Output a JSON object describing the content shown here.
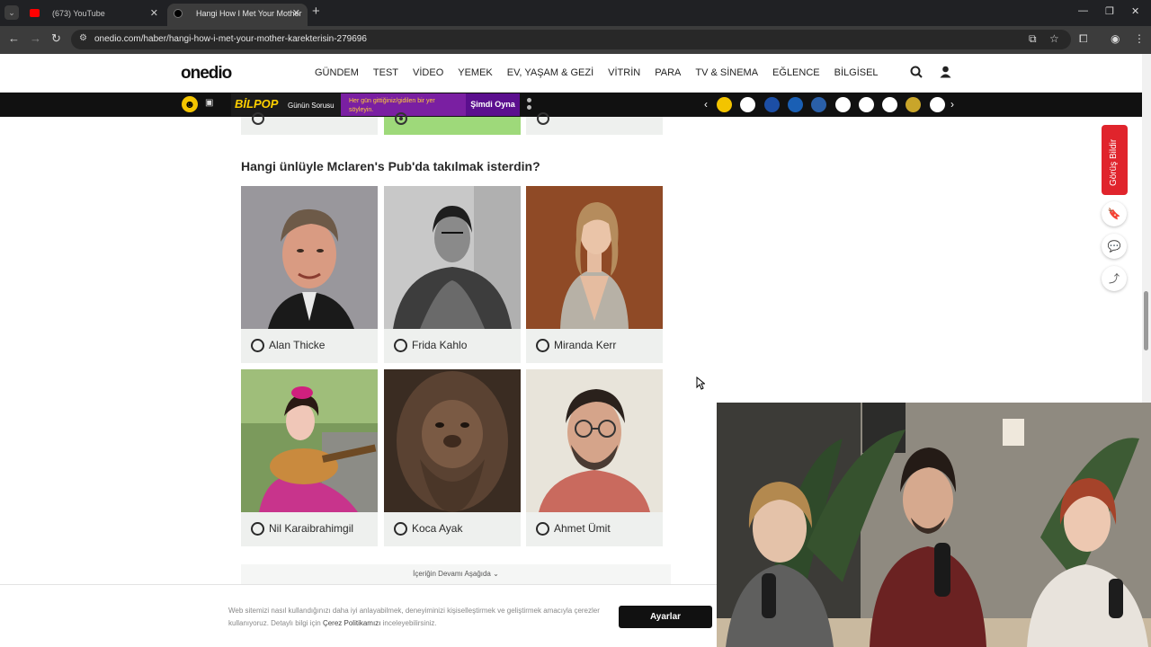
{
  "browser": {
    "tabs": [
      {
        "title": "(673) YouTube"
      },
      {
        "title": "Hangi How I Met Your Mother K"
      }
    ],
    "url": "onedio.com/haber/hangi-how-i-met-your-mother-karekterisin-279696"
  },
  "site": {
    "logo": "onedio",
    "nav": [
      "GÜNDEM",
      "TEST",
      "VİDEO",
      "YEMEK",
      "EV, YAŞAM & GEZİ",
      "VİTRİN",
      "PARA",
      "TV & SİNEMA",
      "EĞLENCE",
      "BİLGİSEL"
    ]
  },
  "subbar": {
    "bilpop_logo": "BİLPOP",
    "bilpop_question": "Günün Sorusu",
    "bilpop_text": "Her gün gittiğiniz/gidilen bir yer söyleyin.",
    "play_label": "Şimdi Oyna",
    "circle_colors": [
      "#f3c400",
      "#ffffff",
      "#1c4ea5",
      "#1a5fb4",
      "#2a5fa8",
      "#ffffff",
      "#ffffff",
      "#ffffff",
      "#c9a52a",
      "#ffffff"
    ]
  },
  "quiz": {
    "question": "Hangi ünlüyle Mclaren's Pub'da takılmak isterdin?",
    "options": [
      {
        "name": "Alan Thicke"
      },
      {
        "name": "Frida Kahlo"
      },
      {
        "name": "Miranda Kerr"
      },
      {
        "name": "Nil Karaibrahimgil"
      },
      {
        "name": "Koca Ayak"
      },
      {
        "name": "Ahmet Ümit"
      }
    ],
    "continue_label": "İçeriğin Devamı Aşağıda ⌄"
  },
  "sidebar": {
    "feedback_label": "Görüş Bildir"
  },
  "cookie": {
    "text_before": "Web sitemizi nasıl kullandığınızı daha iyi anlayabilmek, deneyiminizi kişiselleştirmek ve geliştirmek amacıyla çerezler kullanıyoruz. Detaylı bilgi için ",
    "link": "Çerez Politikamızı",
    "text_after": " inceleyebilirsiniz.",
    "button": "Ayarlar"
  }
}
